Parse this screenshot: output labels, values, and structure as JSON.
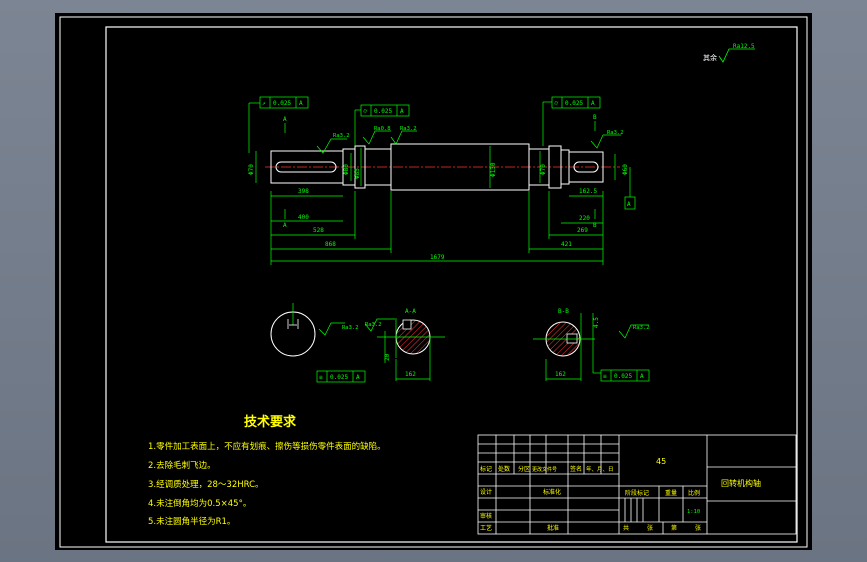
{
  "drawing": {
    "roughness_note": "其余",
    "roughness_note_value": "Ra12.5",
    "tech_title": "技术要求",
    "requirements": [
      "1.零件加工表面上，不应有划痕、擦伤等损伤零件表面的缺陷。",
      "2.去除毛刺飞边。",
      "3.经调质处理，28～32HRC。",
      "4.未注倒角均为0.5×45°。",
      "5.未注圆角半径为R1。"
    ],
    "dimensions": {
      "overall_length": "1679",
      "left_868": "868",
      "left_528": "528",
      "left_400": "400",
      "left_398": "398",
      "right_421": "421",
      "right_269": "269",
      "right_220": "220",
      "right_162_5": "162.5",
      "dia_left_end": "Φ70",
      "dia_left_shoulder": "Φ80",
      "dia_mid1": "Φ85",
      "dia_center": "Φ130",
      "dia_right1": "Φ70",
      "dia_right_end": "Φ60",
      "section_a_depth": "162",
      "section_b_depth": "162",
      "section_b_width": "4.5",
      "section_a_width": "20"
    },
    "gdt": {
      "top_left": [
        "↗",
        "0.025",
        "A"
      ],
      "top_mid": [
        "⌭",
        "0.025",
        "A"
      ],
      "top_right": [
        "⌭",
        "0.025",
        "A"
      ],
      "section_a": [
        "≡",
        "0.025",
        "A"
      ],
      "section_b": [
        "≡",
        "0.025",
        "A"
      ]
    },
    "datums": [
      "A",
      "A",
      "B",
      "B",
      "A"
    ],
    "roughness": [
      "Ra3.2",
      "Ra0.8",
      "Ra3.2",
      "Ra3.2",
      "Ra3.2",
      "Ra3.2",
      "Ra3.2"
    ],
    "sections": {
      "a_label": "A-A",
      "b_label": "B-B"
    }
  },
  "title_block": {
    "material": "45",
    "part_name": "回转机构轴",
    "scale": "1:10",
    "row_labels": [
      "标记",
      "处数",
      "分区",
      "更改文件号",
      "签名",
      "年、月、日"
    ],
    "designer": "设计",
    "standardized": "标准化",
    "stage_mark": "阶段标记",
    "weight": "重量",
    "ratio_label": "比例",
    "reviewer": "审核",
    "process": "工艺",
    "approve": "批准",
    "total": "共",
    "sheet": "张",
    "page": "第",
    "page_end": "张"
  }
}
